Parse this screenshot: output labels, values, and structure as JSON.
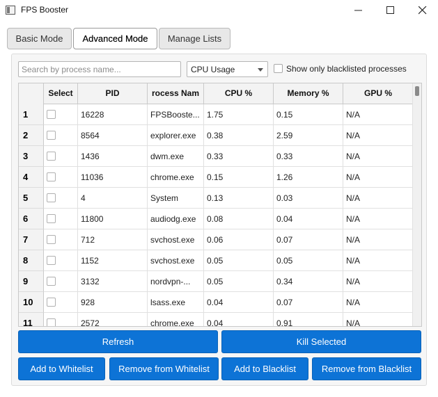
{
  "window": {
    "title": "FPS Booster"
  },
  "tabs": [
    {
      "label": "Basic Mode",
      "active": false
    },
    {
      "label": "Advanced Mode",
      "active": true
    },
    {
      "label": "Manage Lists",
      "active": false
    }
  ],
  "filters": {
    "search_placeholder": "Search by process name...",
    "sort_by": "CPU Usage",
    "blacklist_only_label": "Show only blacklisted processes",
    "blacklist_only_checked": false
  },
  "table": {
    "columns": [
      "Select",
      "PID",
      "rocess Nam",
      "CPU %",
      "Memory %",
      "GPU %"
    ],
    "rows": [
      {
        "num": "1",
        "pid": "16228",
        "name": "FPSBooste...",
        "cpu": "1.75",
        "mem": "0.15",
        "gpu": "N/A"
      },
      {
        "num": "2",
        "pid": "8564",
        "name": "explorer.exe",
        "cpu": "0.38",
        "mem": "2.59",
        "gpu": "N/A"
      },
      {
        "num": "3",
        "pid": "1436",
        "name": "dwm.exe",
        "cpu": "0.33",
        "mem": "0.33",
        "gpu": "N/A"
      },
      {
        "num": "4",
        "pid": "11036",
        "name": "chrome.exe",
        "cpu": "0.15",
        "mem": "1.26",
        "gpu": "N/A"
      },
      {
        "num": "5",
        "pid": "4",
        "name": "System",
        "cpu": "0.13",
        "mem": "0.03",
        "gpu": "N/A"
      },
      {
        "num": "6",
        "pid": "11800",
        "name": "audiodg.exe",
        "cpu": "0.08",
        "mem": "0.04",
        "gpu": "N/A"
      },
      {
        "num": "7",
        "pid": "712",
        "name": "svchost.exe",
        "cpu": "0.06",
        "mem": "0.07",
        "gpu": "N/A"
      },
      {
        "num": "8",
        "pid": "1152",
        "name": "svchost.exe",
        "cpu": "0.05",
        "mem": "0.05",
        "gpu": "N/A"
      },
      {
        "num": "9",
        "pid": "3132",
        "name": "nordvpn-...",
        "cpu": "0.05",
        "mem": "0.34",
        "gpu": "N/A"
      },
      {
        "num": "10",
        "pid": "928",
        "name": "lsass.exe",
        "cpu": "0.04",
        "mem": "0.07",
        "gpu": "N/A"
      },
      {
        "num": "11",
        "pid": "2572",
        "name": "chrome.exe",
        "cpu": "0.04",
        "mem": "0.91",
        "gpu": "N/A"
      }
    ]
  },
  "actions": {
    "refresh": "Refresh",
    "kill": "Kill Selected",
    "add_whitelist": "Add to Whitelist",
    "remove_whitelist": "Remove from Whitelist",
    "add_blacklist": "Add to Blacklist",
    "remove_blacklist": "Remove from Blacklist"
  },
  "colors": {
    "accent": "#0d73d6"
  }
}
